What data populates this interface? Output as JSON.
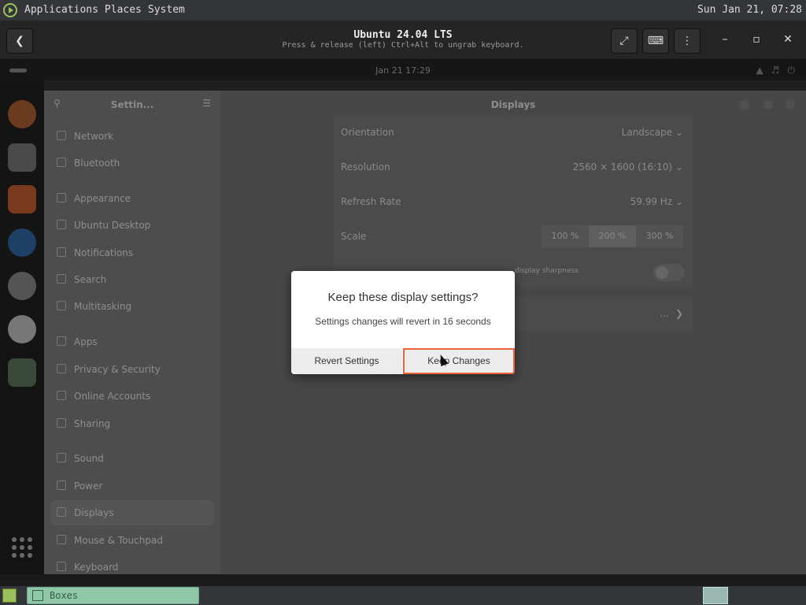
{
  "host_panel": {
    "menus": [
      "Applications",
      "Places",
      "System"
    ],
    "clock": "Sun Jan 21, 07:28"
  },
  "boxes": {
    "vm_title": "Ubuntu 24.04 LTS",
    "hint": "Press & release (left) Ctrl+Alt to ungrab keyboard.",
    "icons": [
      "back-icon",
      "fullscreen-icon",
      "keyboard-icon",
      "menu-icon",
      "minimize-icon",
      "maximize-icon",
      "close-icon"
    ]
  },
  "guest_top": {
    "date": "Jan 21  17:29"
  },
  "settings": {
    "sidebar_title": "Settin...",
    "nav": [
      {
        "label": "Network",
        "icon": "network-icon"
      },
      {
        "label": "Bluetooth",
        "icon": "bluetooth-icon"
      },
      {
        "label": "Appearance",
        "icon": "appearance-icon"
      },
      {
        "label": "Ubuntu Desktop",
        "icon": "desktop-icon"
      },
      {
        "label": "Notifications",
        "icon": "bell-icon"
      },
      {
        "label": "Search",
        "icon": "search-icon"
      },
      {
        "label": "Multitasking",
        "icon": "multitasking-icon"
      },
      {
        "label": "Apps",
        "icon": "apps-icon"
      },
      {
        "label": "Privacy & Security",
        "icon": "lock-icon"
      },
      {
        "label": "Online Accounts",
        "icon": "accounts-icon"
      },
      {
        "label": "Sharing",
        "icon": "share-icon"
      },
      {
        "label": "Sound",
        "icon": "sound-icon"
      },
      {
        "label": "Power",
        "icon": "power-icon"
      },
      {
        "label": "Displays",
        "icon": "display-icon",
        "active": true
      },
      {
        "label": "Mouse & Touchpad",
        "icon": "mouse-icon"
      },
      {
        "label": "Keyboard",
        "icon": "keyboard-icon"
      }
    ],
    "main_title": "Displays",
    "rows": {
      "orientation": {
        "label": "Orientation",
        "value": "Landscape"
      },
      "resolution": {
        "label": "Resolution",
        "value": "2560 × 1600 (16:10)"
      },
      "refresh": {
        "label": "Refresh Rate",
        "value": "59.99 Hz"
      },
      "scale": {
        "label": "Scale",
        "options": [
          "100 %",
          "200 %",
          "300 %"
        ],
        "selected": "200 %"
      },
      "fractional_hint": "display sharpness",
      "more": "…"
    }
  },
  "dialog": {
    "title": "Keep these display settings?",
    "message": "Settings changes will revert in 16 seconds",
    "revert_label": "Revert Settings",
    "keep_label": "Keep Changes",
    "focus_color": "#e9643d"
  },
  "taskbar": {
    "task_label": "Boxes"
  }
}
